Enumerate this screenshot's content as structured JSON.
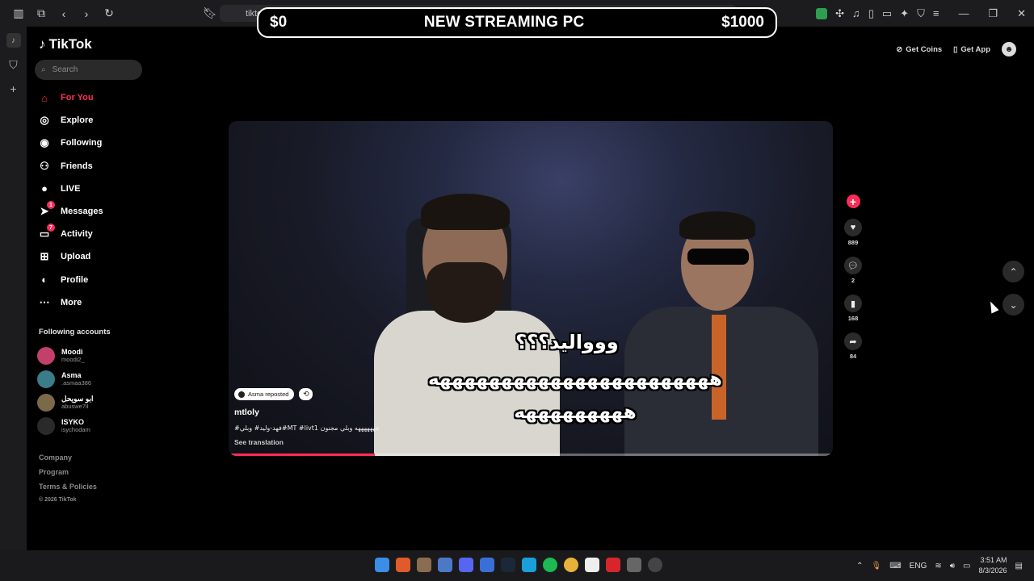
{
  "browser": {
    "url": "tiktok.com"
  },
  "banner": {
    "left": "$0",
    "title": "NEW STREAMING PC",
    "right": "$1000"
  },
  "nav": {
    "logo": "TikTok",
    "search_placeholder": "Search",
    "items": [
      {
        "label": "For You",
        "icon": "home-icon",
        "active": true
      },
      {
        "label": "Explore",
        "icon": "compass-icon"
      },
      {
        "label": "Following",
        "icon": "following-avatar-icon"
      },
      {
        "label": "Friends",
        "icon": "friends-icon"
      },
      {
        "label": "LIVE",
        "icon": "live-icon"
      },
      {
        "label": "Messages",
        "icon": "send-icon",
        "badge": "1"
      },
      {
        "label": "Activity",
        "icon": "activity-icon",
        "badge": "7"
      },
      {
        "label": "Upload",
        "icon": "upload-icon"
      },
      {
        "label": "Profile",
        "icon": "profile-icon"
      },
      {
        "label": "More",
        "icon": "more-icon"
      }
    ],
    "following_title": "Following accounts",
    "accounts": [
      {
        "name": "Moodi",
        "handle": "moodi2_"
      },
      {
        "name": "Asma",
        "handle": ".asmaa386"
      },
      {
        "name": "ابو سويحل",
        "handle": "abuswe7il"
      },
      {
        "name": "ISYKO",
        "handle": "isychodam"
      }
    ],
    "footer": [
      "Company",
      "Program",
      "Terms & Policies"
    ],
    "copyright": "© 2026 TikTok"
  },
  "topbar": {
    "get_coins": "Get Coins",
    "get_app": "Get App"
  },
  "video": {
    "caption_line1": "ووواليد؟؟؟",
    "caption_line2": "هههههههههههههههههههههههه",
    "caption_line3": "هههههههههه",
    "repost_label": "Asma reposted",
    "author": "mtloly",
    "description": "#فهد-وليد# وبلي#MT #livt1 هههههههه وبلي مجنون",
    "see_translation": "See translation",
    "progress": 0.24
  },
  "actions": {
    "likes": "889",
    "comments": "2",
    "saves": "168",
    "shares": "84"
  },
  "taskbar": {
    "lang": "ENG",
    "time": "3:51 AM",
    "date": "8/3/2026"
  }
}
